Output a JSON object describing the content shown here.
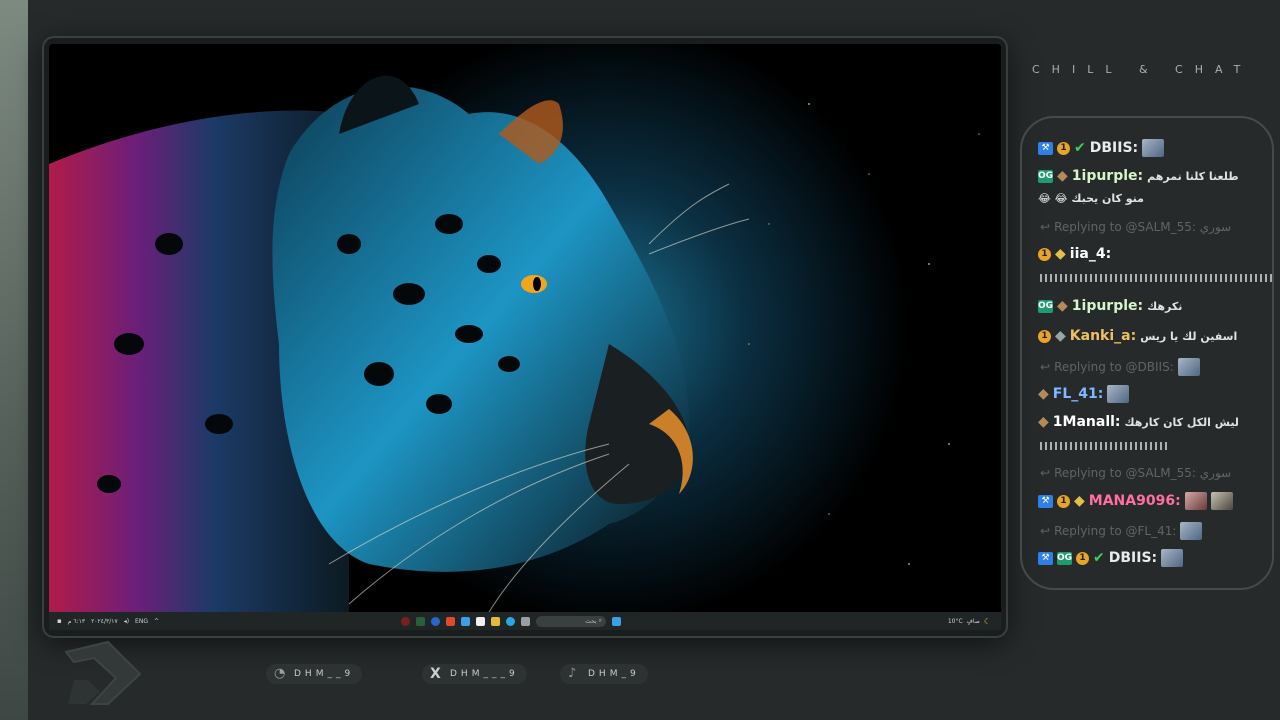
{
  "brand": {
    "text": "CHILL & CHAT"
  },
  "taskbar": {
    "left_text": "٦:١٣ م",
    "left_date": "٢٠٢٤/٣/١٧",
    "lang": "ENG",
    "search_placeholder": "بحث",
    "weather_temp": "10°C",
    "weather_desc": "صافٍ"
  },
  "chat": {
    "messages": [
      {
        "type": "msg",
        "user": "DBIIS:",
        "user_color": "#e9ecec",
        "text": ""
      },
      {
        "type": "msg",
        "user": "1ipurple:",
        "user_color": "#d6f5c9",
        "text": "طلعنا كلنا نمرهم",
        "text2": "منو كان يحبك 😂 😂"
      },
      {
        "type": "reply",
        "text": "Replying to @SALM_55: سوري"
      },
      {
        "type": "msg",
        "user": "iia_4:",
        "user_color": "#ffffff",
        "text": ""
      },
      {
        "type": "msg",
        "user": "1ipurple:",
        "user_color": "#d6f5c9",
        "text": "نكرهك"
      },
      {
        "type": "msg",
        "user": "Kanki_a:",
        "user_color": "#f0c060",
        "text": "اسفين لك يا ريس"
      },
      {
        "type": "reply",
        "text": "Replying to @DBIIS:"
      },
      {
        "type": "msg",
        "user": "FL_41:",
        "user_color": "#7fb9ff",
        "text": ""
      },
      {
        "type": "msg",
        "user": "1Manall:",
        "user_color": "#ffffff",
        "text": "ليش الكل كان كارهك"
      },
      {
        "type": "reply",
        "text": "Replying to @SALM_55: سوري"
      },
      {
        "type": "msg",
        "user": "MANA9096:",
        "user_color": "#ff6fa0",
        "text": ""
      },
      {
        "type": "reply",
        "text": "Replying to @FL_41:"
      },
      {
        "type": "msg",
        "user": "DBIIS:",
        "user_color": "#e9ecec",
        "text": ""
      }
    ]
  },
  "social": [
    {
      "handle": "DHM__9",
      "icon": "snapchat-icon"
    },
    {
      "handle": "DHM___9",
      "icon": "x-icon"
    },
    {
      "handle": "DHM_9",
      "icon": "tiktok-icon"
    }
  ],
  "colors": {
    "bg": "#262a2a",
    "badge_blue": "#2f7fe8",
    "badge_green": "#3ecf5a",
    "badge_orange": "#e8a428"
  }
}
